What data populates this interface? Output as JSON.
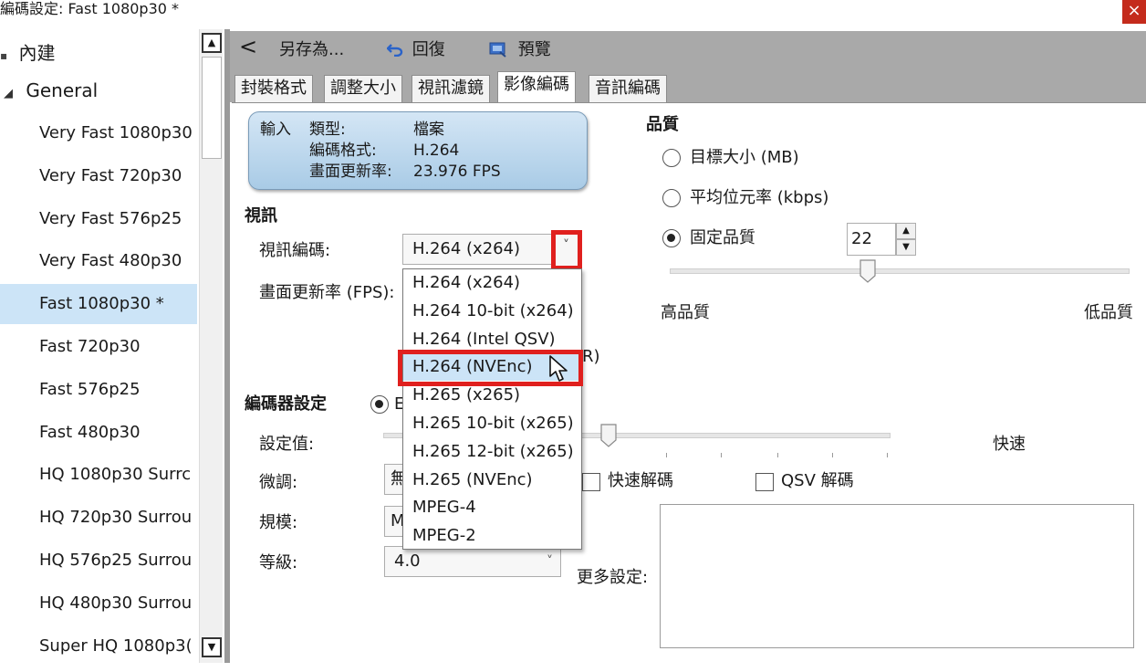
{
  "window": {
    "title": "編碼設定: Fast 1080p30 *",
    "close_glyph": "×"
  },
  "preset_tree": {
    "builtin_label": "內建",
    "general_label": "General",
    "items": [
      "Very Fast 1080p30",
      "Very Fast 720p30",
      "Very Fast 576p25",
      "Very Fast 480p30",
      "Fast 1080p30 *",
      "Fast 720p30",
      "Fast 576p25",
      "Fast 480p30",
      "HQ 1080p30 Surrc",
      "HQ 720p30 Surrou",
      "HQ 576p25 Surrou",
      "HQ 480p30 Surrou",
      "Super HQ 1080p3("
    ],
    "selected_index": 4
  },
  "toolbar": {
    "back_glyph": "<",
    "save_as": "另存為...",
    "revert": "回復",
    "preview": "預覽"
  },
  "tabs": [
    "封裝格式",
    "調整大小",
    "視訊濾鏡",
    "影像編碼",
    "音訊編碼"
  ],
  "active_tab": 3,
  "input_info": {
    "heading": "輸入",
    "type_label": "類型:",
    "type_value": "檔案",
    "codec_label": "編碼格式:",
    "codec_value": "H.264",
    "fps_label": "畫面更新率:",
    "fps_value": "23.976 FPS"
  },
  "video": {
    "section": "視訊",
    "codec_label": "視訊編碼:",
    "codec_value": "H.264 (x264)",
    "fps_label": "畫面更新率 (FPS):",
    "fps_partial": "R)",
    "dropdown_options": [
      "H.264 (x264)",
      "H.264 10-bit (x264)",
      "H.264 (Intel QSV)",
      "H.264 (NVEnc)",
      "H.265 (x265)",
      "H.265 10-bit (x265)",
      "H.265 12-bit (x265)",
      "H.265 (NVEnc)",
      "MPEG-4",
      "MPEG-2"
    ],
    "highlighted_option": 3
  },
  "quality": {
    "section": "品質",
    "target_size": "目標大小 (MB)",
    "avg_bitrate": "平均位元率 (kbps)",
    "constant_quality": "固定品質",
    "cq_value": "22",
    "high_label": "高品質",
    "low_label": "低品質",
    "slider_fraction": 0.43
  },
  "encoder": {
    "section": "編碼器設定",
    "radio_partial": "E",
    "preset_label": "設定值:",
    "fast_label": "快速",
    "tune_label": "微調:",
    "tune_partial": "無",
    "fast_decode": "快速解碼",
    "qsv_decode": "QSV 解碼",
    "profile_label": "規模:",
    "profile_partial": "M",
    "level_label": "等級:",
    "level_value": "4.0",
    "more_settings": "更多設定:",
    "preset_slider_fraction": 0.45
  },
  "colors": {
    "highlight_red": "#e0201e",
    "selection_blue": "#cce4f7",
    "toolbar_gray": "#a9a9a9"
  },
  "icons": {
    "back": "chevron-left-icon",
    "revert": "undo-icon",
    "preview": "preview-icon",
    "dropdown": "chevron-down-icon",
    "cursor": "mouse-pointer-icon"
  }
}
